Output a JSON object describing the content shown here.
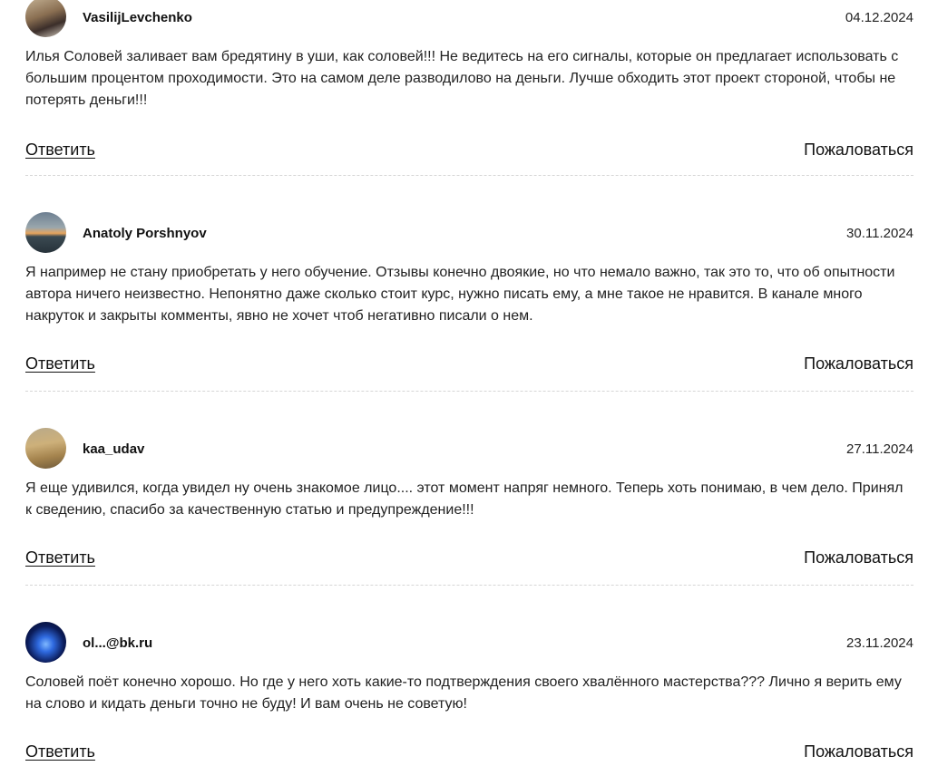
{
  "comments": [
    {
      "author": "VasilijLevchenko",
      "date": "04.12.2024",
      "text": "Илья Соловей заливает вам бредятину в уши, как соловей!!! Не ведитесь на его сигналы, которые он предлагает использовать с большим процентом проходимости. Это на самом деле разводилово на деньги. Лучше обходить этот проект стороной, чтобы не потерять деньги!!!",
      "reply_label": "Ответить",
      "report_label": "Пожаловаться"
    },
    {
      "author": "Anatoly Porshnyov",
      "date": "30.11.2024",
      "text": "Я например не стану приобретать у него обучение. Отзывы конечно двоякие, но что немало важно, так это то, что об опытности автора ничего неизвестно. Непонятно даже сколько стоит курс, нужно писать ему, а мне такое не нравится. В канале много накруток и закрыты комменты, явно не хочет чтоб негативно писали о нем.",
      "reply_label": "Ответить",
      "report_label": "Пожаловаться"
    },
    {
      "author": "kaa_udav",
      "date": "27.11.2024",
      "text": "Я еще удивился, когда увидел ну очень знакомое лицо.... этот момент напряг немного. Теперь хоть понимаю, в чем дело. Принял к сведению, спасибо за качественную статью и предупреждение!!!",
      "reply_label": "Ответить",
      "report_label": "Пожаловаться"
    },
    {
      "author": "ol...@bk.ru",
      "date": "23.11.2024",
      "text": "Соловей поёт конечно хорошо. Но где у него хоть какие-то подтверждения своего хвалённого мастерства??? Лично я верить ему на слово и кидать деньги точно не буду! И вам очень не советую!",
      "reply_label": "Ответить",
      "report_label": "Пожаловаться"
    }
  ]
}
